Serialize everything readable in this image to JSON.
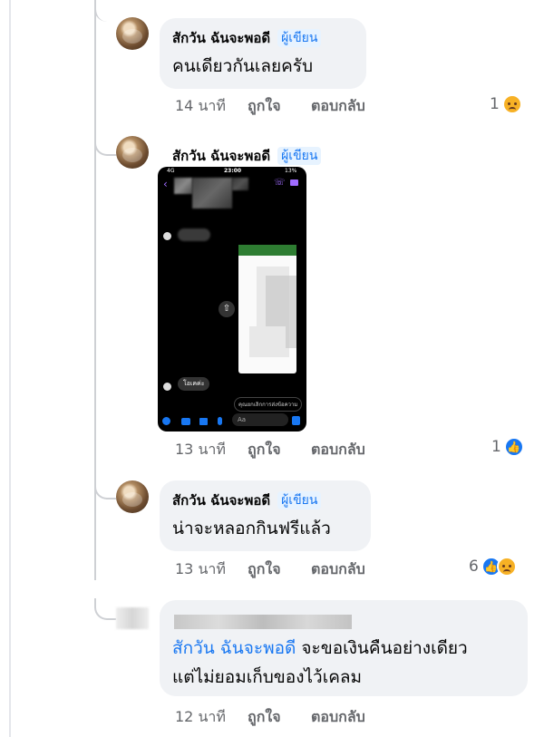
{
  "comments": [
    {
      "author": "สักวัน ฉันจะพอดี",
      "badge": "ผู้เขียน",
      "text": "คนเดียวกันเลยครับ",
      "time": "14 นาที",
      "like_label": "ถูกใจ",
      "reply_label": "ตอบกลับ",
      "reaction_count": "1",
      "reactions": [
        "sad-emoji-icon"
      ]
    },
    {
      "author": "สักวัน ฉันจะพอดี",
      "badge": "ผู้เขียน",
      "attachment": {
        "status_time": "23:00",
        "carrier": "4G",
        "battery": "13%",
        "chat_message": "โอเคค่ะ",
        "input_placeholder": "Aa",
        "reply_hint": "คุณยกเลิกการส่งข้อความ"
      },
      "time": "13 นาที",
      "like_label": "ถูกใจ",
      "reply_label": "ตอบกลับ",
      "reaction_count": "1",
      "reactions": [
        "like-emoji-icon"
      ]
    },
    {
      "author": "สักวัน ฉันจะพอดี",
      "badge": "ผู้เขียน",
      "text": "น่าจะหลอกกินฟรีแล้ว",
      "time": "13 นาที",
      "like_label": "ถูกใจ",
      "reply_label": "ตอบกลับ",
      "reaction_count": "6",
      "reactions": [
        "like-emoji-icon",
        "sad-emoji-icon"
      ]
    },
    {
      "author": "",
      "mention": "สักวัน ฉันจะพอดี",
      "text_after_mention": " จะขอเงินคืนอย่างเดียว",
      "text_line2": "แต่ไม่ยอมเก็บของไว้เคลม",
      "time": "12 นาที",
      "like_label": "ถูกใจ",
      "reply_label": "ตอบกลับ"
    }
  ],
  "colors": {
    "accent": "#1877f2",
    "bubble": "#f0f2f5",
    "secondary_text": "#65676b",
    "sad_emoji": "#f7b125"
  }
}
